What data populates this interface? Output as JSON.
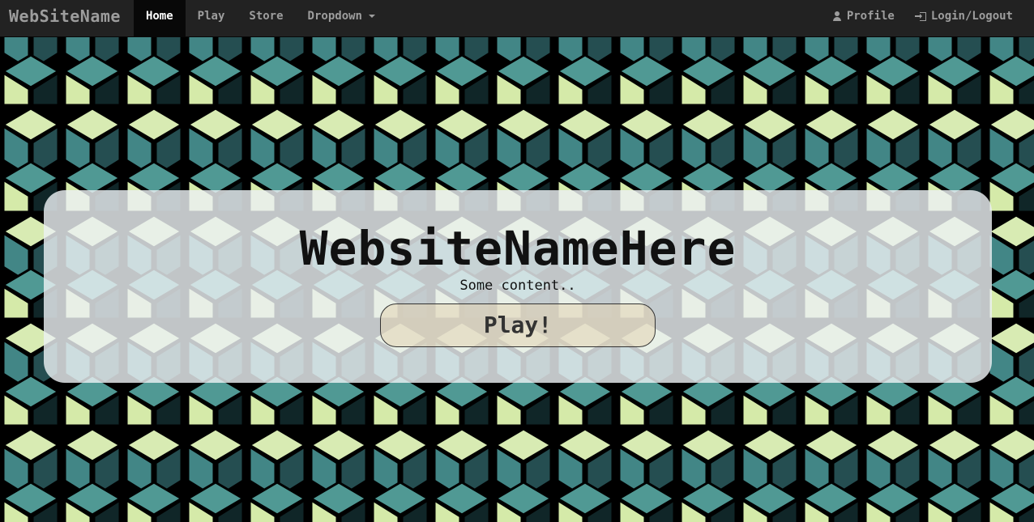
{
  "navbar": {
    "brand": "WebSiteName",
    "items": [
      {
        "label": "Home",
        "active": true
      },
      {
        "label": "Play",
        "active": false
      },
      {
        "label": "Store",
        "active": false
      },
      {
        "label": "Dropdown",
        "active": false
      }
    ],
    "right": {
      "profile_label": "Profile",
      "login_label": "Login/Logout"
    }
  },
  "hero": {
    "title": "WebsiteNameHere",
    "subtitle": "Some content..",
    "button_label": "Play!"
  },
  "icons": {
    "profile": "user-icon",
    "login": "login-icon",
    "dropdown": "caret-down-icon"
  },
  "colors": {
    "navbar_bg": "#222222",
    "nav_active_bg": "#080808",
    "nav_text": "#9d9d9d",
    "cube_light": "#d7ebb0",
    "cube_teal": "#3f8787",
    "cube_dark": "#234e52"
  }
}
